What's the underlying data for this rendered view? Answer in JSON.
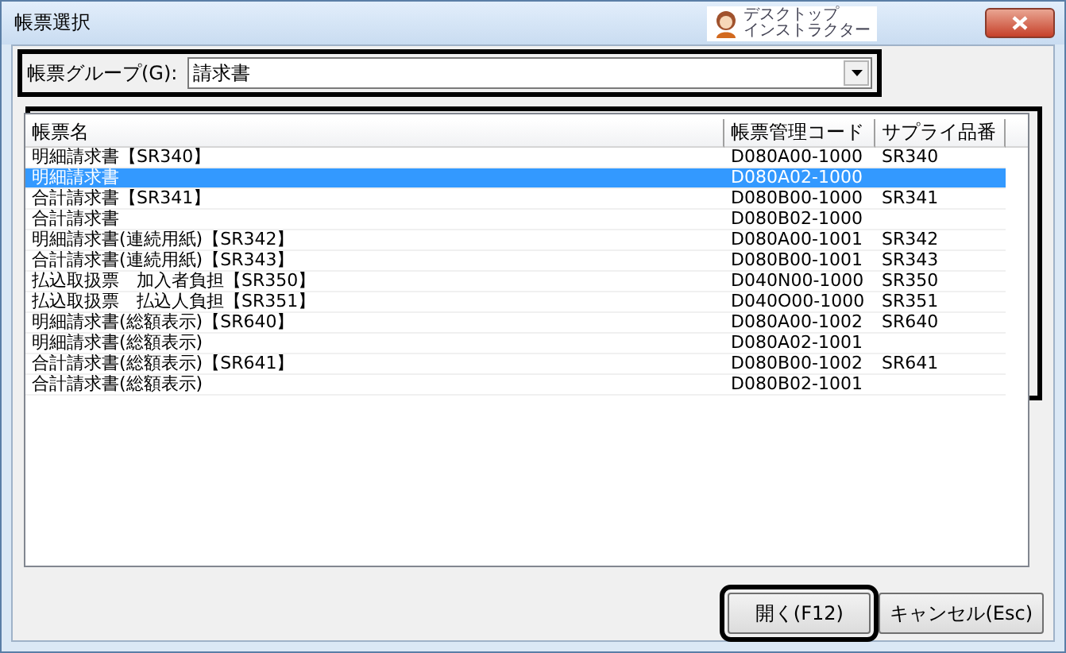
{
  "window": {
    "title": "帳票選択",
    "badge": [
      "デスクトップ",
      "インストラクター"
    ]
  },
  "group_field": {
    "label": "帳票グループ(G):",
    "value": "請求書"
  },
  "table": {
    "columns": [
      "帳票名",
      "帳票管理コード",
      "サプライ品番"
    ],
    "rows": [
      {
        "name": "明細請求書【SR340】",
        "code": "D080A00-1000",
        "supply": "SR340",
        "selected": false
      },
      {
        "name": "明細請求書",
        "code": "D080A02-1000",
        "selected": true
      },
      {
        "name": "合計請求書【SR341】",
        "code": "D080B00-1000",
        "supply": "SR341",
        "selected": false
      },
      {
        "name": "合計請求書",
        "code": "D080B02-1000",
        "selected": false
      },
      {
        "name": "明細請求書(連続用紙)【SR342】",
        "code": "D080A00-1001",
        "supply": "SR342",
        "selected": false
      },
      {
        "name": "合計請求書(連続用紙)【SR343】",
        "code": "D080B00-1001",
        "supply": "SR343",
        "selected": false
      },
      {
        "name": "払込取扱票　加入者負担【SR350】",
        "code": "D040N00-1000",
        "supply": "SR350",
        "selected": false
      },
      {
        "name": "払込取扱票　払込人負担【SR351】",
        "code": "D040O00-1000",
        "supply": "SR351",
        "selected": false
      },
      {
        "name": "明細請求書(総額表示)【SR640】",
        "code": "D080A00-1002",
        "supply": "SR640",
        "selected": false
      },
      {
        "name": "明細請求書(総額表示)",
        "code": "D080A02-1001",
        "selected": false
      },
      {
        "name": "合計請求書(総額表示)【SR641】",
        "code": "D080B00-1002",
        "supply": "SR641",
        "selected": false
      },
      {
        "name": "合計請求書(総額表示)",
        "code": "D080B02-1001",
        "selected": false
      }
    ]
  },
  "buttons": [
    {
      "label": "開く(F12)",
      "default": true
    },
    {
      "label": "キャンセル(Esc)",
      "default": false
    }
  ]
}
